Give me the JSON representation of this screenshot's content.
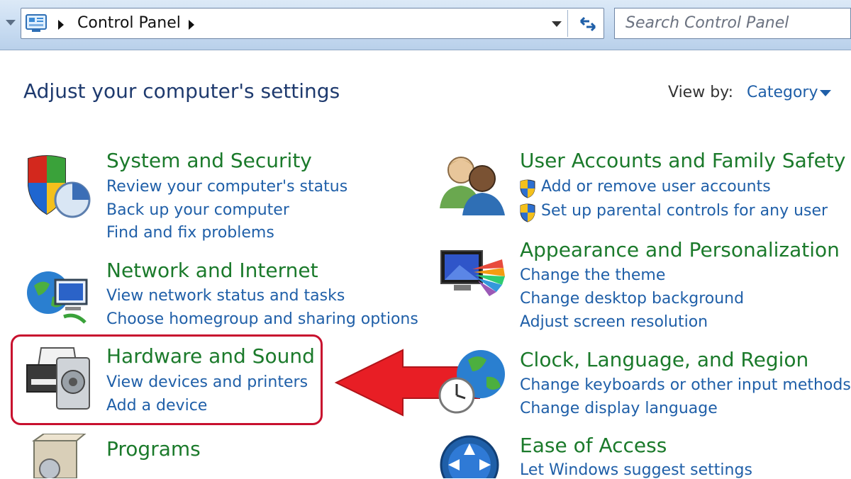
{
  "address_bar": {
    "breadcrumb": "Control Panel",
    "search_placeholder": "Search Control Panel"
  },
  "header": {
    "title": "Adjust your computer's settings",
    "view_by_label": "View by:",
    "view_by_value": "Category"
  },
  "categories": {
    "system_security": {
      "title": "System and Security",
      "links": [
        "Review your computer's status",
        "Back up your computer",
        "Find and fix problems"
      ]
    },
    "network": {
      "title": "Network and Internet",
      "links": [
        "View network status and tasks",
        "Choose homegroup and sharing options"
      ]
    },
    "hardware": {
      "title": "Hardware and Sound",
      "links": [
        "View devices and printers",
        "Add a device"
      ]
    },
    "programs": {
      "title": "Programs"
    },
    "user_accounts": {
      "title": "User Accounts and Family Safety",
      "links": [
        "Add or remove user accounts",
        "Set up parental controls for any user"
      ]
    },
    "appearance": {
      "title": "Appearance and Personalization",
      "links": [
        "Change the theme",
        "Change desktop background",
        "Adjust screen resolution"
      ]
    },
    "clock": {
      "title": "Clock, Language, and Region",
      "links": [
        "Change keyboards or other input methods",
        "Change display language"
      ]
    },
    "ease": {
      "title": "Ease of Access",
      "links": [
        "Let Windows suggest settings"
      ]
    }
  },
  "colors": {
    "category_title": "#1b7a2b",
    "link": "#1f5fa8",
    "highlight": "#c8102e"
  }
}
